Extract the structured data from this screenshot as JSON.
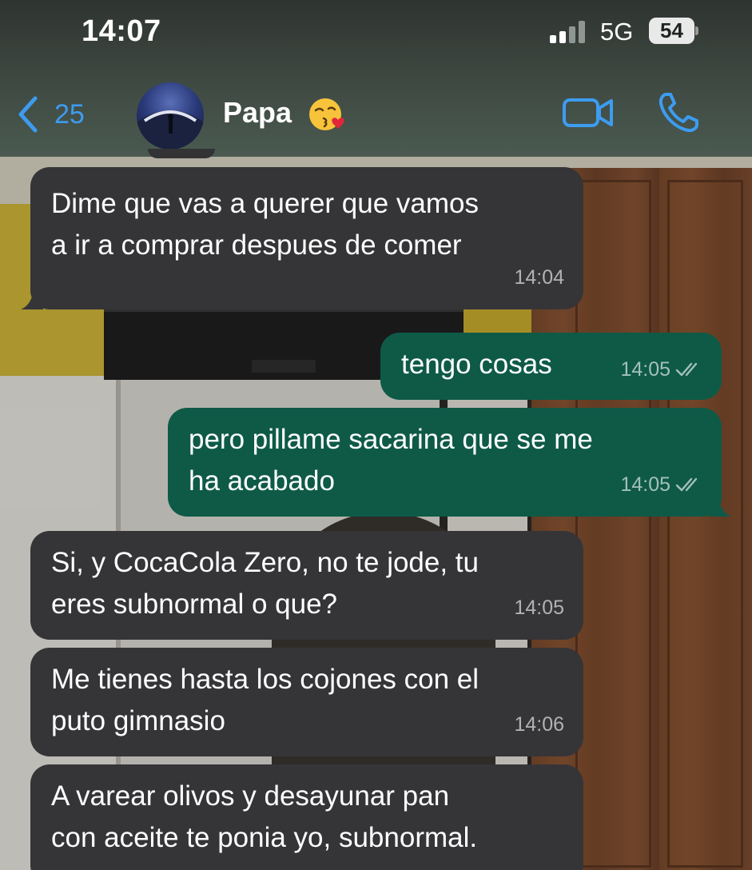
{
  "status_bar": {
    "time": "14:07",
    "network": "5G",
    "battery": "54"
  },
  "header": {
    "back_count": "25",
    "contact_name": "Papa",
    "contact_emoji": "face-blowing-a-kiss",
    "icons": [
      "chevron-left-icon",
      "video-call-icon",
      "phone-call-icon"
    ]
  },
  "messages": [
    {
      "direction": "incoming",
      "text": "Dime que vas a querer que vamos\na ir a comprar despues de comer",
      "time": "14:04"
    },
    {
      "direction": "outgoing",
      "text": "tengo cosas",
      "time": "14:05",
      "read": true
    },
    {
      "direction": "outgoing",
      "text": "pero pillame sacarina que se me\nha acabado",
      "time": "14:05",
      "read": true
    },
    {
      "direction": "incoming",
      "text": "Si, y CocaCola Zero, no te jode, tu\neres subnormal o que?",
      "time": "14:05"
    },
    {
      "direction": "incoming",
      "text": "Me tienes hasta los cojones con el\nputo gimnasio",
      "time": "14:06"
    },
    {
      "direction": "incoming",
      "text": "A varear olivos y desayunar pan\ncon aceite te ponia yo, subnormal.",
      "time": ""
    }
  ],
  "colors": {
    "accent_blue": "#3d9cf0",
    "incoming_bubble": "#353538",
    "outgoing_bubble": "#0e5a47"
  }
}
